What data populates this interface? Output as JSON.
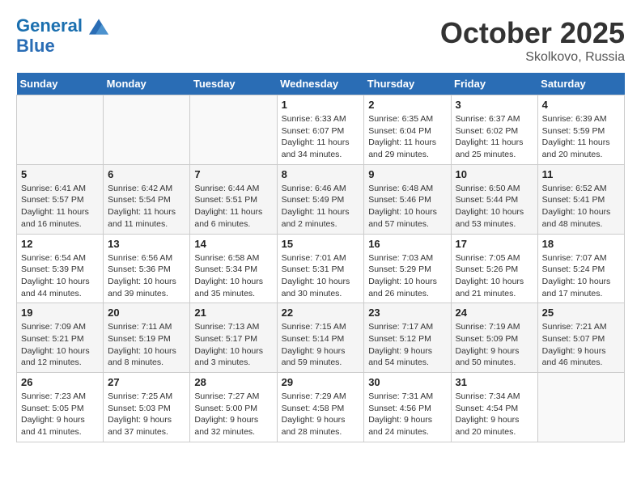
{
  "header": {
    "logo_line1": "General",
    "logo_line2": "Blue",
    "month": "October 2025",
    "location": "Skolkovo, Russia"
  },
  "days_of_week": [
    "Sunday",
    "Monday",
    "Tuesday",
    "Wednesday",
    "Thursday",
    "Friday",
    "Saturday"
  ],
  "weeks": [
    [
      {
        "day": "",
        "info": ""
      },
      {
        "day": "",
        "info": ""
      },
      {
        "day": "",
        "info": ""
      },
      {
        "day": "1",
        "info": "Sunrise: 6:33 AM\nSunset: 6:07 PM\nDaylight: 11 hours and 34 minutes."
      },
      {
        "day": "2",
        "info": "Sunrise: 6:35 AM\nSunset: 6:04 PM\nDaylight: 11 hours and 29 minutes."
      },
      {
        "day": "3",
        "info": "Sunrise: 6:37 AM\nSunset: 6:02 PM\nDaylight: 11 hours and 25 minutes."
      },
      {
        "day": "4",
        "info": "Sunrise: 6:39 AM\nSunset: 5:59 PM\nDaylight: 11 hours and 20 minutes."
      }
    ],
    [
      {
        "day": "5",
        "info": "Sunrise: 6:41 AM\nSunset: 5:57 PM\nDaylight: 11 hours and 16 minutes."
      },
      {
        "day": "6",
        "info": "Sunrise: 6:42 AM\nSunset: 5:54 PM\nDaylight: 11 hours and 11 minutes."
      },
      {
        "day": "7",
        "info": "Sunrise: 6:44 AM\nSunset: 5:51 PM\nDaylight: 11 hours and 6 minutes."
      },
      {
        "day": "8",
        "info": "Sunrise: 6:46 AM\nSunset: 5:49 PM\nDaylight: 11 hours and 2 minutes."
      },
      {
        "day": "9",
        "info": "Sunrise: 6:48 AM\nSunset: 5:46 PM\nDaylight: 10 hours and 57 minutes."
      },
      {
        "day": "10",
        "info": "Sunrise: 6:50 AM\nSunset: 5:44 PM\nDaylight: 10 hours and 53 minutes."
      },
      {
        "day": "11",
        "info": "Sunrise: 6:52 AM\nSunset: 5:41 PM\nDaylight: 10 hours and 48 minutes."
      }
    ],
    [
      {
        "day": "12",
        "info": "Sunrise: 6:54 AM\nSunset: 5:39 PM\nDaylight: 10 hours and 44 minutes."
      },
      {
        "day": "13",
        "info": "Sunrise: 6:56 AM\nSunset: 5:36 PM\nDaylight: 10 hours and 39 minutes."
      },
      {
        "day": "14",
        "info": "Sunrise: 6:58 AM\nSunset: 5:34 PM\nDaylight: 10 hours and 35 minutes."
      },
      {
        "day": "15",
        "info": "Sunrise: 7:01 AM\nSunset: 5:31 PM\nDaylight: 10 hours and 30 minutes."
      },
      {
        "day": "16",
        "info": "Sunrise: 7:03 AM\nSunset: 5:29 PM\nDaylight: 10 hours and 26 minutes."
      },
      {
        "day": "17",
        "info": "Sunrise: 7:05 AM\nSunset: 5:26 PM\nDaylight: 10 hours and 21 minutes."
      },
      {
        "day": "18",
        "info": "Sunrise: 7:07 AM\nSunset: 5:24 PM\nDaylight: 10 hours and 17 minutes."
      }
    ],
    [
      {
        "day": "19",
        "info": "Sunrise: 7:09 AM\nSunset: 5:21 PM\nDaylight: 10 hours and 12 minutes."
      },
      {
        "day": "20",
        "info": "Sunrise: 7:11 AM\nSunset: 5:19 PM\nDaylight: 10 hours and 8 minutes."
      },
      {
        "day": "21",
        "info": "Sunrise: 7:13 AM\nSunset: 5:17 PM\nDaylight: 10 hours and 3 minutes."
      },
      {
        "day": "22",
        "info": "Sunrise: 7:15 AM\nSunset: 5:14 PM\nDaylight: 9 hours and 59 minutes."
      },
      {
        "day": "23",
        "info": "Sunrise: 7:17 AM\nSunset: 5:12 PM\nDaylight: 9 hours and 54 minutes."
      },
      {
        "day": "24",
        "info": "Sunrise: 7:19 AM\nSunset: 5:09 PM\nDaylight: 9 hours and 50 minutes."
      },
      {
        "day": "25",
        "info": "Sunrise: 7:21 AM\nSunset: 5:07 PM\nDaylight: 9 hours and 46 minutes."
      }
    ],
    [
      {
        "day": "26",
        "info": "Sunrise: 7:23 AM\nSunset: 5:05 PM\nDaylight: 9 hours and 41 minutes."
      },
      {
        "day": "27",
        "info": "Sunrise: 7:25 AM\nSunset: 5:03 PM\nDaylight: 9 hours and 37 minutes."
      },
      {
        "day": "28",
        "info": "Sunrise: 7:27 AM\nSunset: 5:00 PM\nDaylight: 9 hours and 32 minutes."
      },
      {
        "day": "29",
        "info": "Sunrise: 7:29 AM\nSunset: 4:58 PM\nDaylight: 9 hours and 28 minutes."
      },
      {
        "day": "30",
        "info": "Sunrise: 7:31 AM\nSunset: 4:56 PM\nDaylight: 9 hours and 24 minutes."
      },
      {
        "day": "31",
        "info": "Sunrise: 7:34 AM\nSunset: 4:54 PM\nDaylight: 9 hours and 20 minutes."
      },
      {
        "day": "",
        "info": ""
      }
    ]
  ]
}
